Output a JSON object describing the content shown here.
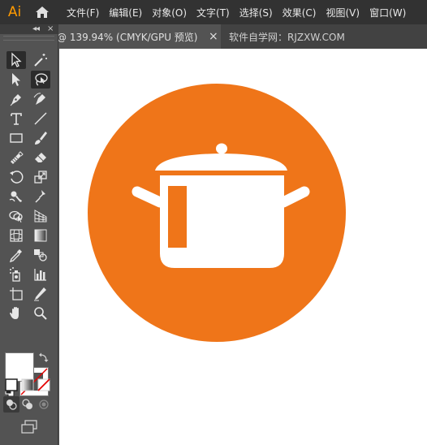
{
  "app": {
    "logo": "Ai",
    "menus": [
      "文件(F)",
      "编辑(E)",
      "对象(O)",
      "文字(T)",
      "选择(S)",
      "效果(C)",
      "视图(V)",
      "窗口(W)"
    ]
  },
  "tabs": [
    {
      "label": "@ 139.94% (CMYK/GPU 预览)",
      "close": "×",
      "active": true
    },
    {
      "label": "软件自学网：RJZXW.COM",
      "active": false
    }
  ],
  "panel": {
    "collapse_glyph": "◂◂",
    "close_glyph": "×"
  },
  "tools": [
    "selection-tool",
    "magic-wand-tool",
    "direct-selection-tool",
    "lasso-tool",
    "pen-tool",
    "curvature-tool",
    "type-tool",
    "line-segment-tool",
    "rectangle-tool",
    "paintbrush-tool",
    "shaper-tool",
    "eraser-tool",
    "rotate-tool",
    "scale-tool",
    "warp-tool",
    "puppet-warp-tool",
    "shape-builder-tool",
    "perspective-grid-tool",
    "mesh-tool",
    "gradient-tool",
    "eyedropper-tool",
    "blend-tool",
    "symbol-sprayer-tool",
    "column-graph-tool",
    "artboard-tool",
    "slice-tool",
    "hand-tool",
    "zoom-tool"
  ],
  "colors": {
    "accent": "#ef7519",
    "fill": "#ffffff",
    "stroke": "#ffffff",
    "menubar": "#323232",
    "panel": "#535353",
    "logo": "#ff9a00"
  },
  "artwork": {
    "subject": "cooking-pot-icon"
  }
}
